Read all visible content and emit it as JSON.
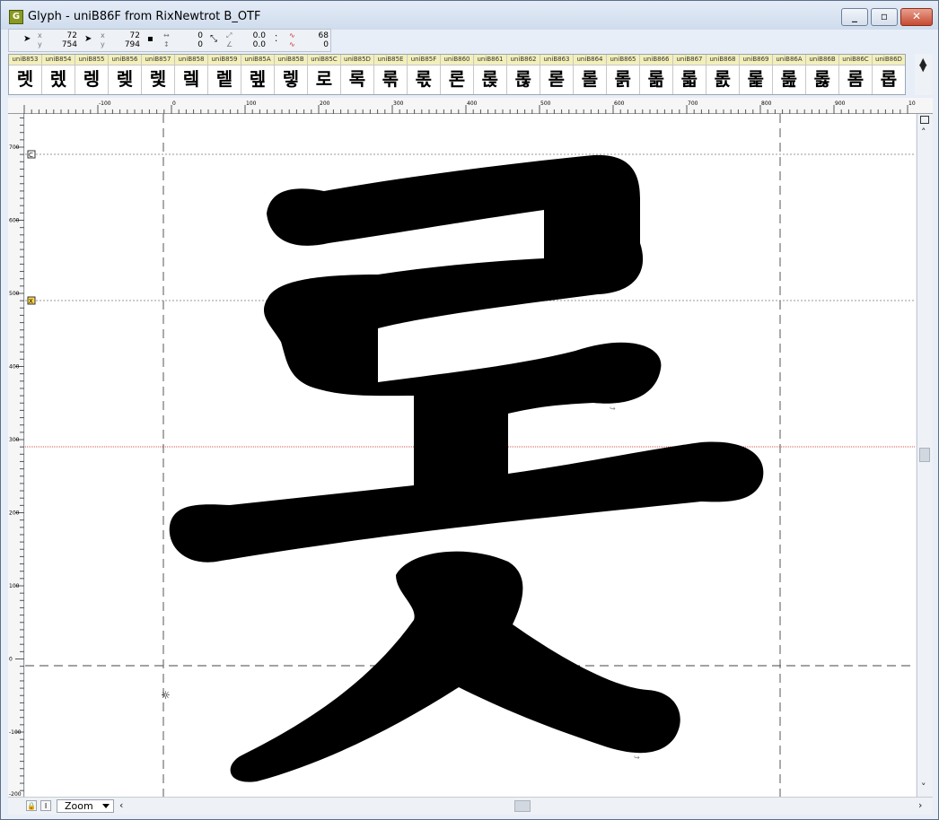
{
  "window": {
    "title": "Glyph - uniB86F from RixNewtrot B_OTF",
    "icon": "G"
  },
  "toolbar": {
    "pointer": {
      "x": "72",
      "y": "754"
    },
    "selection": {
      "x": "72",
      "y": "794"
    },
    "delta": {
      "x": "0",
      "y": "0"
    },
    "transform": {
      "a": "0.0",
      "b": "0.0"
    },
    "nodes": {
      "a": "68",
      "b": "0"
    }
  },
  "glyph_strip": [
    {
      "name": "uniB853",
      "char": "렛"
    },
    {
      "name": "uniB854",
      "char": "렜"
    },
    {
      "name": "uniB855",
      "char": "렝"
    },
    {
      "name": "uniB856",
      "char": "렞"
    },
    {
      "name": "uniB857",
      "char": "렟"
    },
    {
      "name": "uniB858",
      "char": "렠"
    },
    {
      "name": "uniB859",
      "char": "렡"
    },
    {
      "name": "uniB85A",
      "char": "렢"
    },
    {
      "name": "uniB85B",
      "char": "렣"
    },
    {
      "name": "uniB85C",
      "char": "로"
    },
    {
      "name": "uniB85D",
      "char": "록"
    },
    {
      "name": "uniB85E",
      "char": "롞"
    },
    {
      "name": "uniB85F",
      "char": "롟"
    },
    {
      "name": "uniB860",
      "char": "론"
    },
    {
      "name": "uniB861",
      "char": "롡"
    },
    {
      "name": "uniB862",
      "char": "롢"
    },
    {
      "name": "uniB863",
      "char": "롣"
    },
    {
      "name": "uniB864",
      "char": "롤"
    },
    {
      "name": "uniB865",
      "char": "롥"
    },
    {
      "name": "uniB866",
      "char": "롦"
    },
    {
      "name": "uniB867",
      "char": "롧"
    },
    {
      "name": "uniB868",
      "char": "롨"
    },
    {
      "name": "uniB869",
      "char": "롩"
    },
    {
      "name": "uniB86A",
      "char": "롪"
    },
    {
      "name": "uniB86B",
      "char": "롫"
    },
    {
      "name": "uniB86C",
      "char": "롬"
    },
    {
      "name": "uniB86D",
      "char": "롭"
    }
  ],
  "rulers": {
    "horizontal": [
      "-100",
      "0",
      "100",
      "200",
      "300",
      "400",
      "500",
      "600",
      "700",
      "800",
      "900",
      "10"
    ],
    "vertical": [
      "700",
      "600",
      "500",
      "400",
      "300",
      "200",
      "100",
      "0",
      "-100",
      "-200"
    ]
  },
  "guides": {
    "cap_label": "C",
    "x_label": "X"
  },
  "status": {
    "zoom": "Zoom"
  },
  "colors": {
    "guideline": "#d9534f",
    "strip_header": "#f3efb9"
  }
}
